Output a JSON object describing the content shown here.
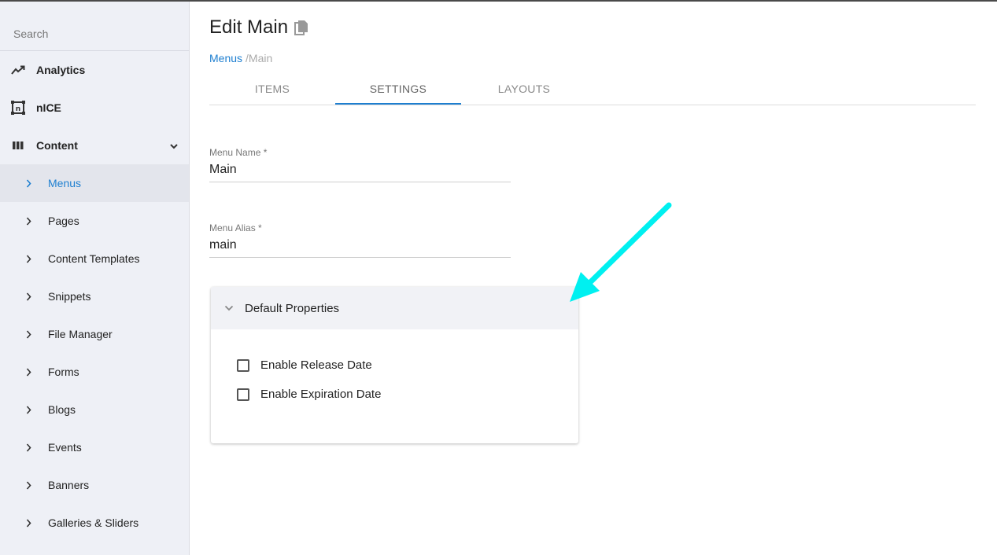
{
  "sidebar": {
    "search_placeholder": "Search",
    "top_items": [
      {
        "label": "Analytics",
        "icon": "trending-up-icon"
      },
      {
        "label": "nICE",
        "icon": "nice-logo-icon"
      },
      {
        "label": "Content",
        "icon": "columns-icon",
        "expanded": true
      }
    ],
    "sub_items": [
      {
        "label": "Menus",
        "active": true
      },
      {
        "label": "Pages"
      },
      {
        "label": "Content Templates"
      },
      {
        "label": "Snippets"
      },
      {
        "label": "File Manager"
      },
      {
        "label": "Forms"
      },
      {
        "label": "Blogs"
      },
      {
        "label": "Events"
      },
      {
        "label": "Banners"
      },
      {
        "label": "Galleries & Sliders"
      }
    ]
  },
  "header": {
    "title": "Edit Main",
    "breadcrumb": {
      "link": "Menus",
      "current": "/Main"
    }
  },
  "tabs": [
    {
      "label": "ITEMS"
    },
    {
      "label": "SETTINGS",
      "active": true
    },
    {
      "label": "LAYOUTS"
    }
  ],
  "form": {
    "menu_name": {
      "label": "Menu Name *",
      "value": "Main"
    },
    "menu_alias": {
      "label": "Menu Alias *",
      "value": "main"
    }
  },
  "panel": {
    "title": "Default Properties",
    "options": [
      {
        "label": "Enable Release Date",
        "checked": false
      },
      {
        "label": "Enable Expiration Date",
        "checked": false
      }
    ]
  },
  "colors": {
    "accent": "#1e7fd0",
    "annotation_arrow": "#00f0f0"
  }
}
